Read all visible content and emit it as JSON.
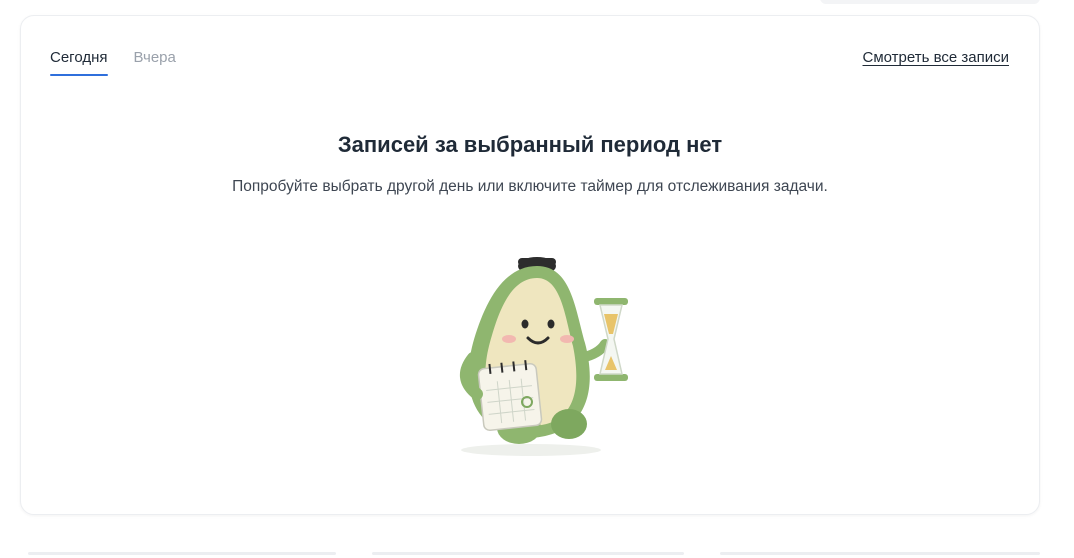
{
  "tabs": [
    {
      "label": "Сегодня",
      "active": true
    },
    {
      "label": "Вчера",
      "active": false
    }
  ],
  "view_all_link": "Смотреть все записи",
  "empty_state": {
    "title": "Записей за выбранный период нет",
    "subtitle": "Попробуйте выбрать другой день или включите таймер для отслеживания задачи.",
    "illustration": "avocado-mascot-with-calendar-and-hourglass"
  },
  "colors": {
    "accent": "#2f6fdc",
    "text": "#1f2a37",
    "muted": "#9aa1ab",
    "avocado_skin": "#8fb66f",
    "avocado_flesh": "#efe6bf"
  }
}
